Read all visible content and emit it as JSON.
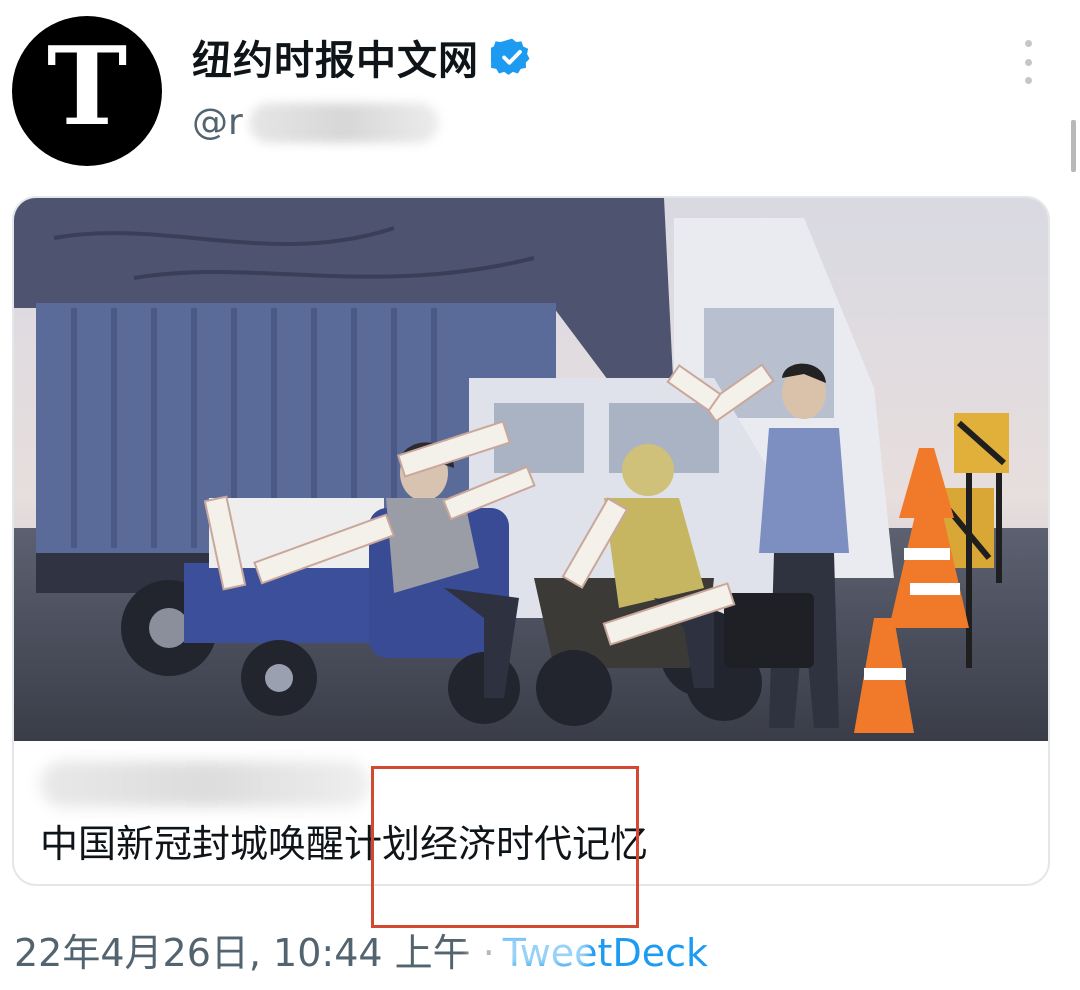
{
  "account": {
    "display_name": "纽约时报中文网",
    "avatar_glyph": "T",
    "handle_prefix": "@r",
    "verified": true,
    "verified_color": "#1d9bf0"
  },
  "icons": [
    "verified-badge-icon",
    "more-options-icon"
  ],
  "card": {
    "title": "中国新冠封城唤醒计划经济时代记忆"
  },
  "tweet": {
    "timestamp": "22年4月26日, 10:44 上午 ·",
    "source": "TweetDeck"
  },
  "colors": {
    "link": "#1d9bf0",
    "muted_text": "#536471",
    "highlight_box": "#d24830"
  }
}
